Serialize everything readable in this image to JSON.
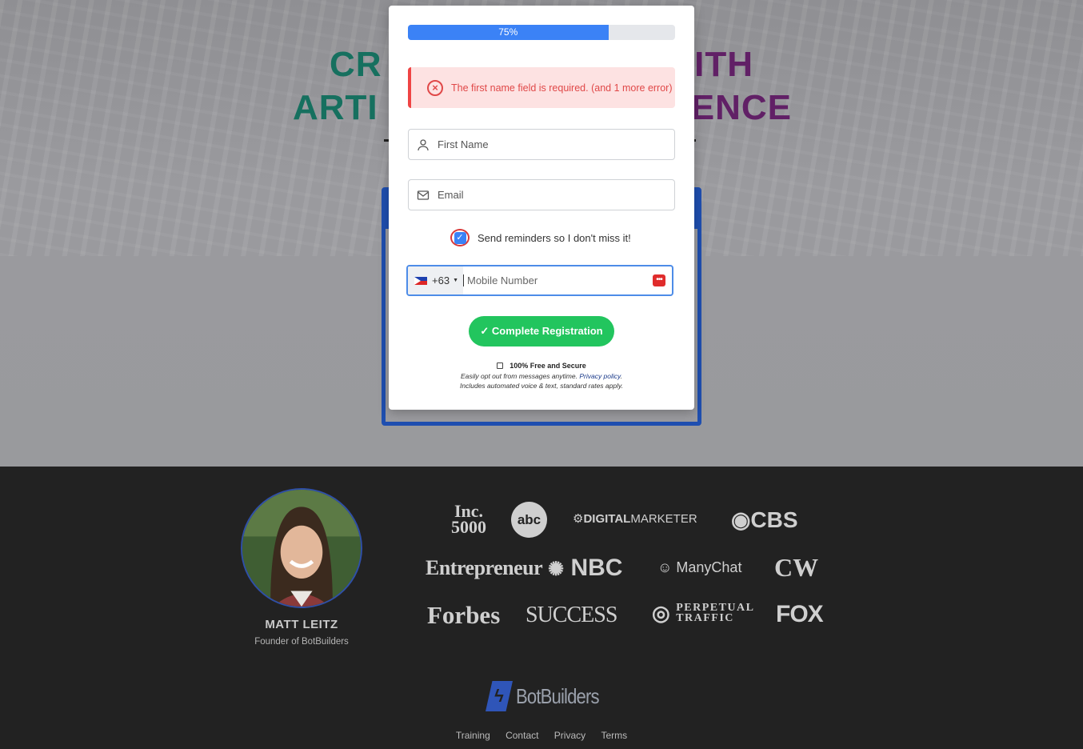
{
  "hero": {
    "headline_line1_left": "CR",
    "headline_line1_right": "ITH",
    "headline_line2_left": "ARTI",
    "headline_line2_right": "ENCE"
  },
  "form": {
    "progress_label": "75%",
    "progress_value": 0.75,
    "error_message": "The first name field is required. (and 1 more error)",
    "first_name_placeholder": "First Name",
    "email_placeholder": "Email",
    "reminders_label": "Send reminders so I don't miss it!",
    "reminders_checked": true,
    "country_code": "+63",
    "mobile_placeholder": "Mobile Number",
    "submit_label": "✓ Complete Registration",
    "secure_label": "100% Free and Secure",
    "fine_print_1": "Easily opt out from messages anytime.",
    "privacy_link": "Privacy policy",
    "fine_print_2": "Includes automated voice & text, standard rates apply."
  },
  "footer": {
    "author_name": "MATT LEITZ",
    "author_role": "Founder of BotBuilders",
    "logos": {
      "inc_line1": "Inc.",
      "inc_line2": "5000",
      "abc": "abc",
      "digital_bold": "DIGITAL",
      "digital_rest": "MARKETER",
      "cbs": "◉CBS",
      "entrepreneur": "Entrepreneur",
      "nbc": "NBC",
      "manychat": "ManyChat",
      "cw": "CW",
      "forbes": "Forbes",
      "success": "SUCCESS",
      "perpetual_line1": "PERPETUAL",
      "perpetual_line2": "TRAFFIC",
      "fox": "FOX"
    },
    "brand": "BotBuilders",
    "links": [
      "Training",
      "Contact",
      "Privacy",
      "Terms"
    ]
  },
  "colors": {
    "progress": "#3b82f6",
    "submit": "#22c55e",
    "error": "#e04848",
    "frame": "#1f4fb0"
  }
}
